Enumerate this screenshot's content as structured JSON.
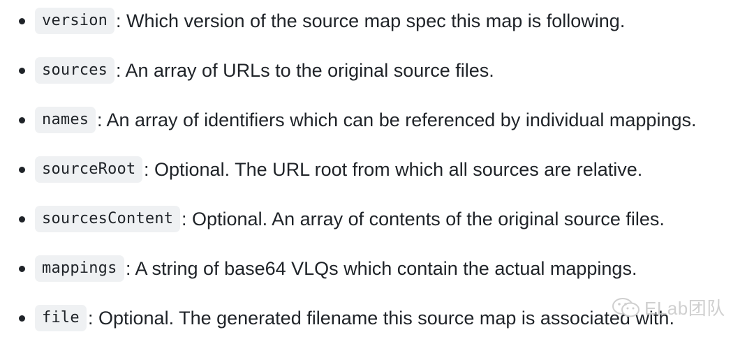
{
  "items": [
    {
      "code": "version",
      "text": ": Which version of the source map spec this map is following."
    },
    {
      "code": "sources",
      "text": ": An array of URLs to the original source files."
    },
    {
      "code": "names",
      "text": ": An array of identifiers which can be referenced by individual mappings."
    },
    {
      "code": "sourceRoot",
      "text": ": Optional. The URL root from which all sources are relative."
    },
    {
      "code": "sourcesContent",
      "text": ": Optional. An array of contents of the original source files."
    },
    {
      "code": "mappings",
      "text": ": A string of base64 VLQs which contain the actual mappings."
    },
    {
      "code": "file",
      "text": ": Optional. The generated filename this source map is associated with."
    }
  ],
  "watermark": {
    "text": "ELab团队",
    "icon": "wechat-icon"
  },
  "colors": {
    "text": "#1f2328",
    "code_bg": "#eff1f3",
    "watermark": "#c8c8c8"
  }
}
